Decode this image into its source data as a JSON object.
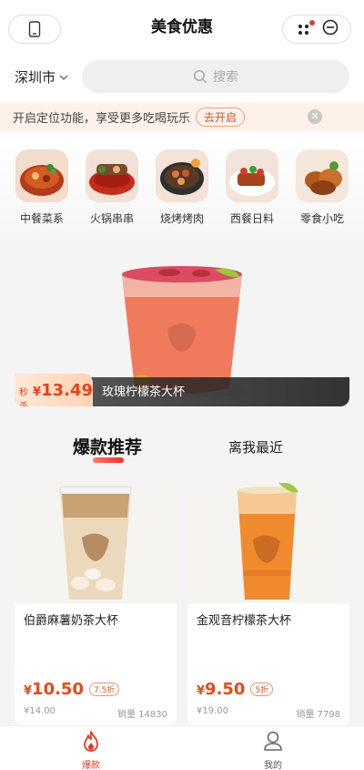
{
  "header": {
    "title": "美食优惠"
  },
  "location": {
    "city": "深圳市",
    "search_placeholder": "搜索"
  },
  "notice": {
    "text": "开启定位功能，享受更多吃喝玩乐",
    "button": "去开启"
  },
  "categories": [
    {
      "label": "中餐菜系",
      "icon": "chinese-food-icon"
    },
    {
      "label": "火锅串串",
      "icon": "hotpot-icon"
    },
    {
      "label": "烧烤烤肉",
      "icon": "bbq-icon"
    },
    {
      "label": "西餐日料",
      "icon": "western-food-icon"
    },
    {
      "label": "零食小吃",
      "icon": "snack-icon"
    }
  ],
  "banner": {
    "badge": "秒杀",
    "currency": "¥",
    "price": "13.49",
    "name": "玫瑰柠檬茶大杯"
  },
  "tabs": [
    {
      "label": "爆款推荐",
      "active": true
    },
    {
      "label": "离我最近",
      "active": false
    }
  ],
  "products": [
    {
      "name": "伯爵麻薯奶茶大杯",
      "currency": "¥",
      "price": "10.50",
      "discount": "7.5折",
      "original": "¥14.00",
      "sales": "销量 14830"
    },
    {
      "name": "金观音柠檬茶大杯",
      "currency": "¥",
      "price": "9.50",
      "discount": "5折",
      "original": "¥19.00",
      "sales": "销量 7798"
    }
  ],
  "bottom_nav": [
    {
      "label": "爆款",
      "icon": "flame-icon",
      "active": true
    },
    {
      "label": "我的",
      "icon": "user-icon",
      "active": false
    }
  ],
  "colors": {
    "accent": "#e8391f",
    "price": "#e34b1a",
    "notice_bg": "#fdf1ea"
  }
}
